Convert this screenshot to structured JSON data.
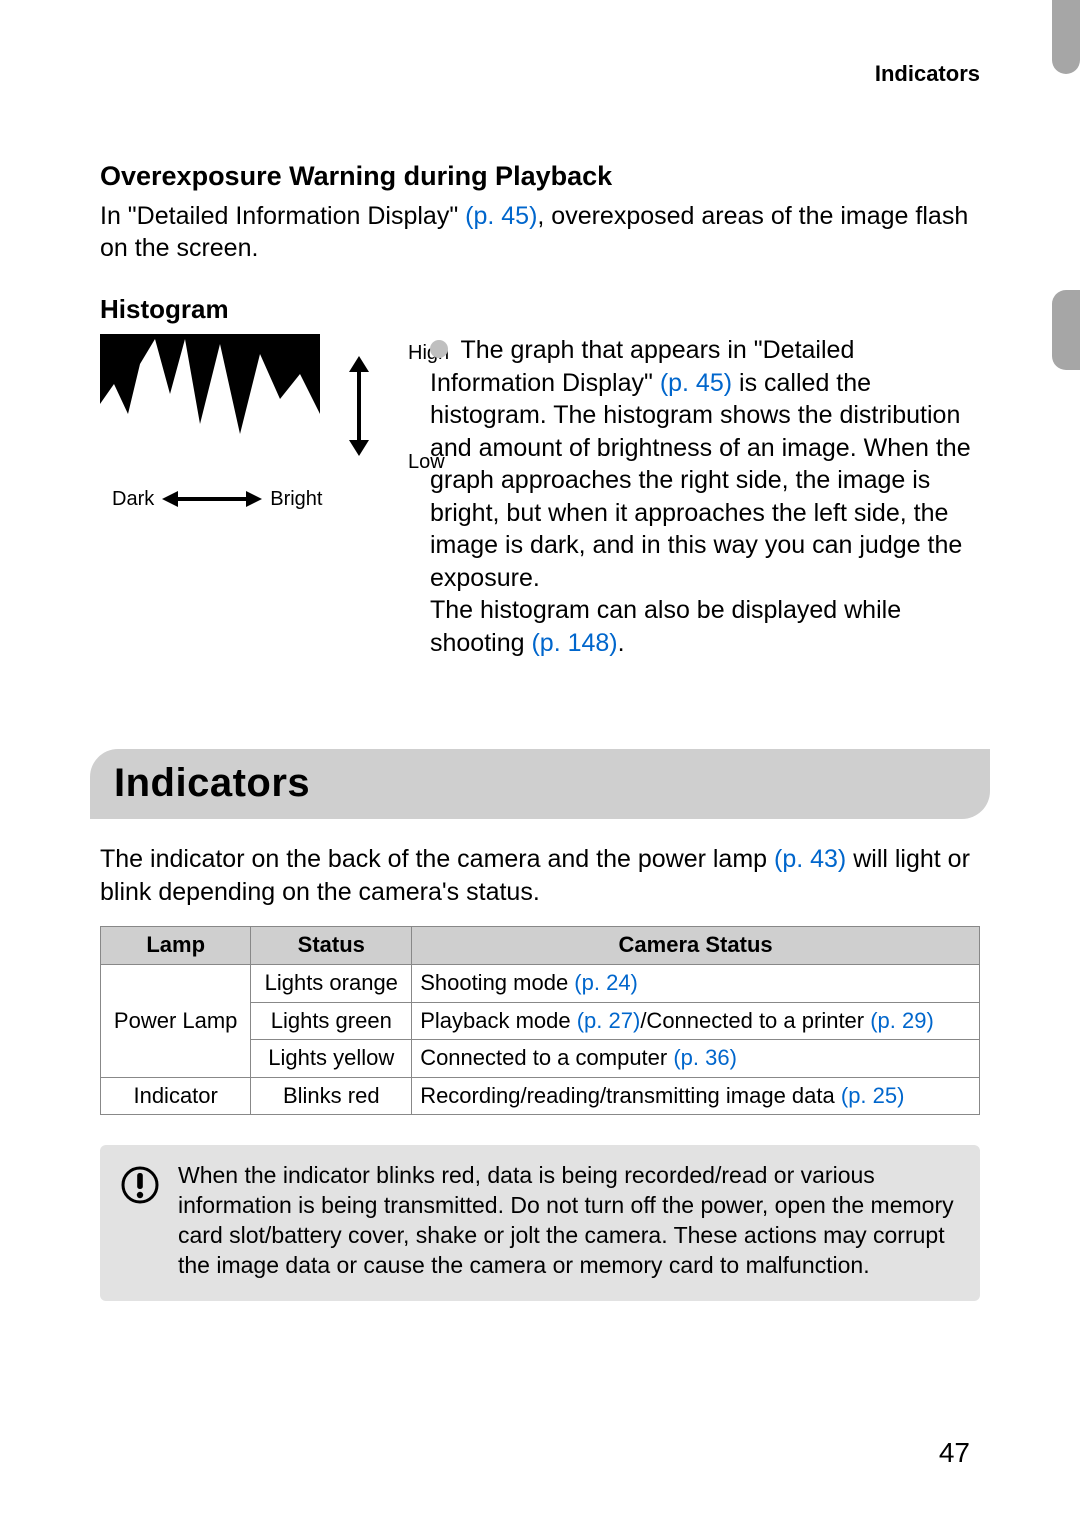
{
  "header_label": "Indicators",
  "section1": {
    "heading": "Overexposure Warning during Playback",
    "para_a": "In \"Detailed Information Display\" ",
    "para_link": "(p. 45)",
    "para_b": ", overexposed areas of the image flash on the screen."
  },
  "histogram": {
    "heading": "Histogram",
    "high": "High",
    "low": "Low",
    "dark": "Dark",
    "bright": "Bright",
    "text_a": "The graph that appears in \"Detailed Information Display\" ",
    "text_link1": "(p. 45)",
    "text_b": " is called the histogram. The histogram shows the distribution and amount of brightness of an image. When the graph approaches the right side, the image is bright, but when it approaches the left side, the image is dark, and in this way you can judge the exposure.",
    "text_c": "The histogram can also be displayed while shooting ",
    "text_link2": "(p. 148)",
    "text_d": "."
  },
  "indicators_section": {
    "heading": "Indicators",
    "intro_a": "The indicator on the back of the camera and the power lamp ",
    "intro_link": "(p. 43)",
    "intro_b": " will light or blink depending on the camera's status."
  },
  "table": {
    "headers": {
      "c0": "Lamp",
      "c1": "Status",
      "c2": "Camera Status"
    },
    "rows": [
      {
        "lamp": "Power Lamp",
        "status": "Lights orange",
        "cs_a": "Shooting mode ",
        "cs_link": "(p. 24)",
        "cs_b": ""
      },
      {
        "lamp": "",
        "status": "Lights green",
        "cs_a": "Playback mode ",
        "cs_link": "(p. 27)",
        "cs_b": "/Connected to a printer ",
        "cs_link2": "(p. 29)"
      },
      {
        "lamp": "",
        "status": "Lights yellow",
        "cs_a": "Connected to a computer ",
        "cs_link": "(p. 36)",
        "cs_b": ""
      },
      {
        "lamp": "Indicator",
        "status": "Blinks red",
        "cs_a": "Recording/reading/transmitting image data ",
        "cs_link": "(p. 25)",
        "cs_b": ""
      }
    ]
  },
  "warning": "When the indicator blinks red, data is being recorded/read or various information is being transmitted. Do not turn off the power, open the memory card slot/battery cover, shake or jolt the camera. These actions may corrupt the image data or cause the camera or memory card to malfunction.",
  "page_number": "47"
}
